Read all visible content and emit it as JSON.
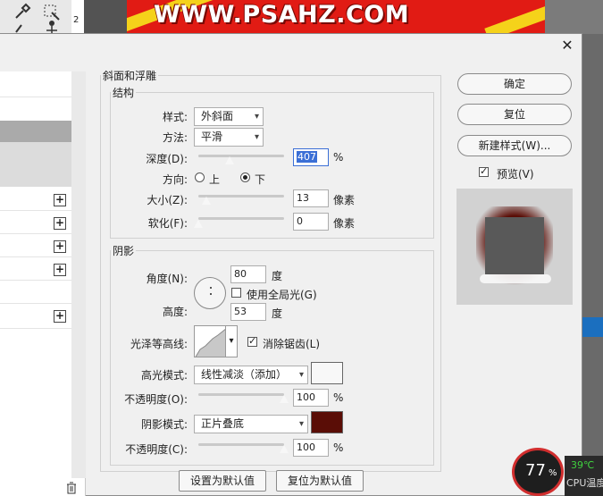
{
  "background": {
    "banner_text": "WWW.PSAHZ.COM",
    "ruler_number": "2"
  },
  "dialog": {
    "close_glyph": "✕",
    "outer_group_title": "斜面和浮雕",
    "structure": {
      "title": "结构",
      "style_label": "样式:",
      "style_value": "外斜面",
      "technique_label": "方法:",
      "technique_value": "平滑",
      "depth_label": "深度(D):",
      "depth_value": "407",
      "depth_unit": "%",
      "depth_fraction": 0.36,
      "direction_label": "方向:",
      "direction_up": "上",
      "direction_down": "下",
      "direction_selected": "下",
      "size_label": "大小(Z):",
      "size_value": "13",
      "size_unit": "像素",
      "size_fraction": 0.09,
      "soften_label": "软化(F):",
      "soften_value": "0",
      "soften_unit": "像素",
      "soften_fraction": 0.0
    },
    "shading": {
      "title": "阴影",
      "angle_label": "角度(N):",
      "angle_value": "80",
      "angle_unit": "度",
      "global_light_label": "使用全局光(G)",
      "global_light_checked": false,
      "altitude_label": "高度:",
      "altitude_value": "53",
      "altitude_unit": "度",
      "gloss_contour_label": "光泽等高线:",
      "anti_alias_label": "消除锯齿(L)",
      "anti_alias_checked": true,
      "highlight_mode_label": "高光模式:",
      "highlight_mode_value": "线性减淡（添加）",
      "highlight_color": "#f8f8f8",
      "highlight_opacity_label": "不透明度(O):",
      "highlight_opacity_value": "100",
      "highlight_opacity_unit": "%",
      "shadow_mode_label": "阴影模式:",
      "shadow_mode_value": "正片叠底",
      "shadow_color": "#5a0d06",
      "shadow_opacity_label": "不透明度(C):",
      "shadow_opacity_value": "100",
      "shadow_opacity_unit": "%"
    },
    "buttons": {
      "make_default": "设置为默认值",
      "reset_default": "复位为默认值",
      "ok": "确定",
      "reset": "复位",
      "new_style": "新建样式(W)...",
      "preview_label": "预览(V)",
      "preview_checked": true
    },
    "left_panel": {
      "plus_glyph": "+",
      "trash_icon": "trash-icon"
    }
  },
  "overlay": {
    "cpu_percent": "77",
    "percent_sign": "%",
    "cpu_temp": "39℃",
    "cpu_temp_label": "CPU温度",
    "accent_red": "#d12e2e",
    "accent_green": "#3fd13f"
  }
}
